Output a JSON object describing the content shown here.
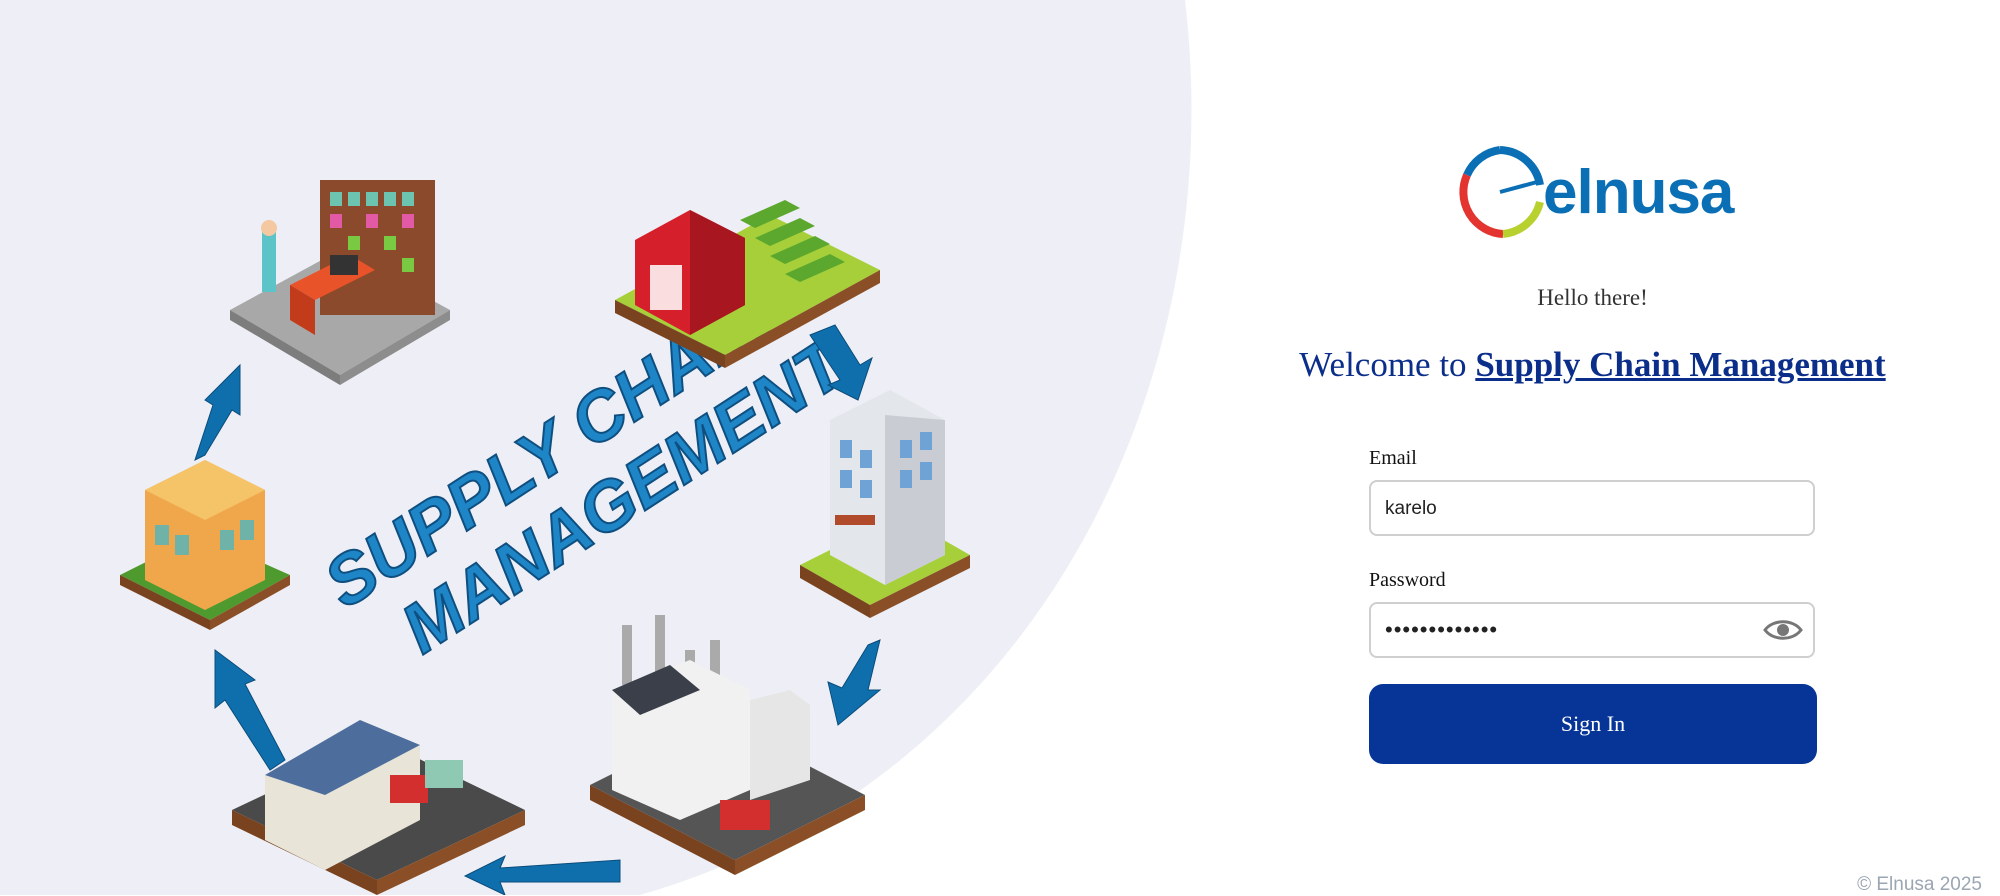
{
  "hero": {
    "illustration_title_line1": "SUPPLY CHAIN",
    "illustration_title_line2": "MANAGEMENT"
  },
  "brand": {
    "logo_text": "elnusa",
    "logo_colors": [
      "#0a6fb5",
      "#e3342f",
      "#b8d12f"
    ]
  },
  "login": {
    "greeting": "Hello there!",
    "welcome_prefix": "Welcome to ",
    "welcome_app": "Supply Chain Management",
    "email_label": "Email",
    "email_value": "karelo",
    "password_label": "Password",
    "password_value": "•••••••••••••",
    "show_password_icon": "eye-icon",
    "signin_label": "Sign In"
  },
  "footer": {
    "copyright": "© Elnusa 2025"
  },
  "colors": {
    "primary": "#063597",
    "heading": "#0b2e8a",
    "panel_bg": "#eeeff6"
  }
}
